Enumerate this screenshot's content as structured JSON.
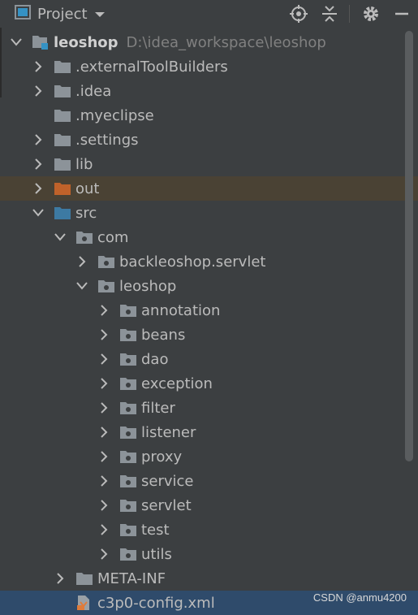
{
  "toolbar": {
    "title": "Project",
    "icons": [
      "project-view-icon",
      "chevron-down-icon",
      "locate-icon",
      "collapse-all-icon",
      "gear-icon",
      "minimize-icon"
    ]
  },
  "tree": {
    "root": {
      "label": "leoshop",
      "path": "D:\\idea_workspace\\leoshop"
    },
    "items": [
      {
        "label": ".externalToolBuilders"
      },
      {
        "label": ".idea"
      },
      {
        "label": ".myeclipse"
      },
      {
        "label": ".settings"
      },
      {
        "label": "lib"
      },
      {
        "label": "out"
      },
      {
        "label": "src"
      },
      {
        "label": "com"
      },
      {
        "label": "backleoshop.servlet"
      },
      {
        "label": "leoshop"
      },
      {
        "label": "annotation"
      },
      {
        "label": "beans"
      },
      {
        "label": "dao"
      },
      {
        "label": "exception"
      },
      {
        "label": "filter"
      },
      {
        "label": "listener"
      },
      {
        "label": "proxy"
      },
      {
        "label": "service"
      },
      {
        "label": "servlet"
      },
      {
        "label": "test"
      },
      {
        "label": "utils"
      },
      {
        "label": "META-INF"
      },
      {
        "label": "c3p0-config.xml"
      }
    ]
  },
  "colors": {
    "background": "#3c3f41",
    "folder": "#8c9399",
    "out_folder": "#c0622a",
    "src_folder": "#3d7aa3",
    "highlight": "#4a4234",
    "selected": "#2f4b6b"
  },
  "watermark": "CSDN @anmu4200"
}
